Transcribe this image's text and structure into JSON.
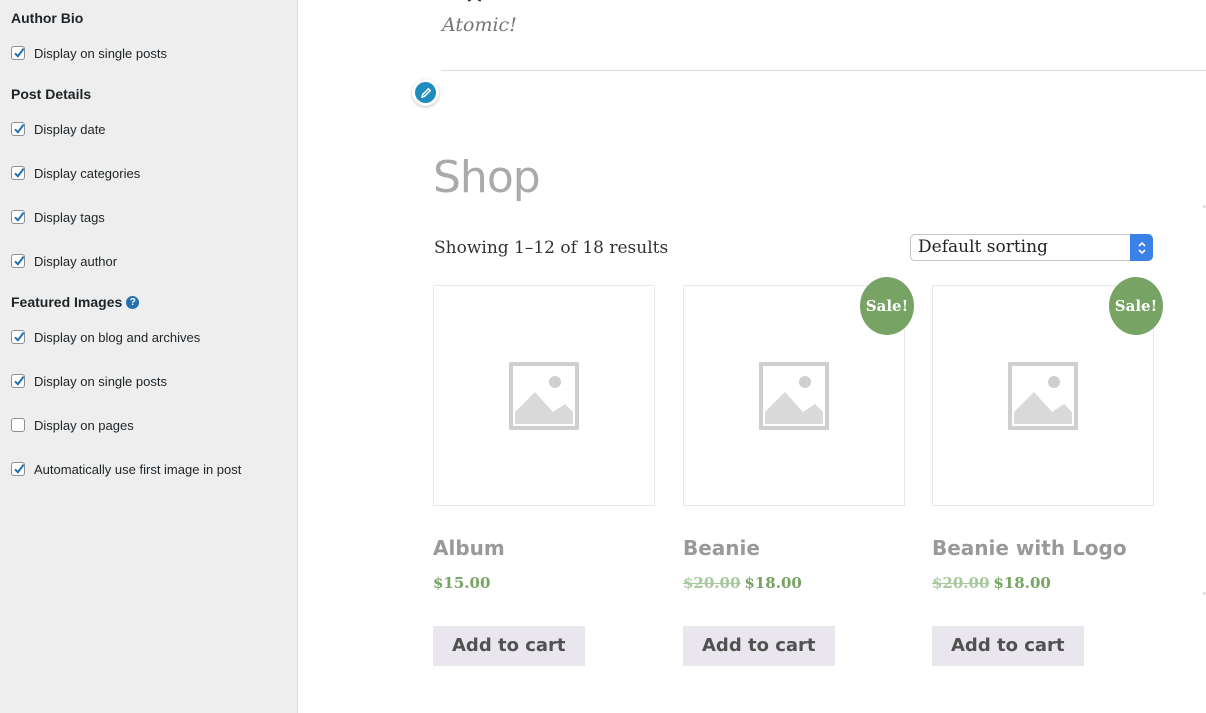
{
  "sidebar": {
    "author_bio": {
      "title": "Author Bio",
      "options": [
        {
          "label": "Display on single posts",
          "checked": true
        }
      ]
    },
    "post_details": {
      "title": "Post Details",
      "options": [
        {
          "label": "Display date",
          "checked": true
        },
        {
          "label": "Display categories",
          "checked": true
        },
        {
          "label": "Display tags",
          "checked": true
        },
        {
          "label": "Display author",
          "checked": true
        }
      ]
    },
    "featured_images": {
      "title": "Featured Images",
      "help": "?",
      "options": [
        {
          "label": "Display on blog and archives",
          "checked": true
        },
        {
          "label": "Display on single posts",
          "checked": true
        },
        {
          "label": "Display on pages",
          "checked": false
        },
        {
          "label": "Automatically use first image in post",
          "checked": true
        }
      ]
    }
  },
  "preview": {
    "tagline": "Atomic!",
    "shop_title": "Shop",
    "result_count": "Showing 1–12 of 18 results",
    "sorting": {
      "selected": "Default sorting"
    },
    "products": [
      {
        "name": "Album",
        "price": "$15.00",
        "old_price": "",
        "sale": false,
        "button": "Add to cart"
      },
      {
        "name": "Beanie",
        "price": "$18.00",
        "old_price": "$20.00",
        "sale": true,
        "badge": "Sale!",
        "button": "Add to cart"
      },
      {
        "name": "Beanie with Logo",
        "price": "$18.00",
        "old_price": "$20.00",
        "sale": true,
        "badge": "Sale!",
        "button": "Add to cart"
      }
    ]
  },
  "colors": {
    "sale_green": "#77a464",
    "checkbox_blue": "#2271b1",
    "edit_blue": "#1e8cbe",
    "select_blue": "#3b82e8"
  }
}
